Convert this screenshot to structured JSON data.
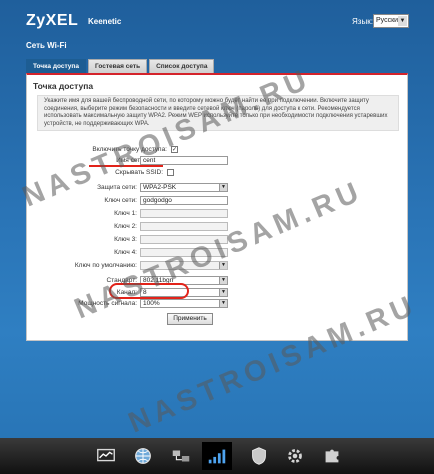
{
  "header": {
    "brand": "ZyXEL",
    "model": "Keenetic",
    "language_label": "Язык:",
    "language_value": "Русский",
    "page_title": "Сеть Wi-Fi"
  },
  "tabs": [
    {
      "label": "Точка доступа",
      "active": true
    },
    {
      "label": "Гостевая сеть",
      "active": false
    },
    {
      "label": "Список доступа",
      "active": false
    }
  ],
  "panel": {
    "title": "Точка доступа",
    "info_text": "Укажите имя для вашей беспроводной сети, по которому можно будет найти ее при подключении. Включите защиту соединения, выберите режим безопасности и введите сетевой ключ (пароль) для доступа к сети. Рекомендуется использовать максимальную защиту WPA2. Режим WEP используйте только при необходимости подключения устаревших устройств, не поддерживающих WPA."
  },
  "form": {
    "enable_label": "Включить точку доступа:",
    "enable_checked": "✓",
    "ssid_label": "Имя сети (SSID):",
    "ssid_value": "cent",
    "hide_ssid_label": "Скрывать SSID:",
    "security_label": "Защита сети:",
    "security_value": "WPA2-PSK",
    "key_label": "Ключ сети:",
    "key_value": "godgodgo",
    "key1_label": "Ключ 1:",
    "key2_label": "Ключ 2:",
    "key3_label": "Ключ 3:",
    "key4_label": "Ключ 4:",
    "default_key_label": "Ключ по умолчанию:",
    "standard_label": "Стандарт:",
    "standard_value": "802.11bgn",
    "channel_label": "Канал:",
    "channel_value": "8",
    "power_label": "Мощность сигнала:",
    "power_value": "100%",
    "apply_label": "Применить"
  },
  "watermark": "NASTROISAM.RU",
  "dock": [
    {
      "name": "monitor-icon"
    },
    {
      "name": "internet-globe-icon"
    },
    {
      "name": "home-network-icon"
    },
    {
      "name": "wifi-signal-icon",
      "active": true
    },
    {
      "name": "security-shield-icon"
    },
    {
      "name": "system-gear-icon"
    },
    {
      "name": "applications-puzzle-icon"
    }
  ],
  "colors": {
    "accent_red": "#e2231a",
    "active_tab": "#1d5d93"
  }
}
